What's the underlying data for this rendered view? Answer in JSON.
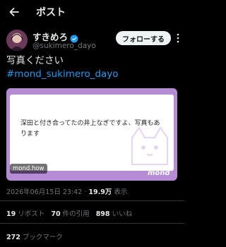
{
  "header": {
    "title": "ポスト"
  },
  "author": {
    "name": "すきめろ",
    "handle": "@sukimero_dayo",
    "follow_label": "フォローする"
  },
  "tweet": {
    "text": "写真ください",
    "hashtag": "#mond_sukimero_dayo"
  },
  "card": {
    "text": "深田と付き合ってたの井上なぎですよ、写真もあります",
    "domain": "mond.how",
    "logo": "mond"
  },
  "meta": {
    "date": "2026年06月15日 23:42",
    "separator": "·",
    "views": "19.9万",
    "views_label": "表示"
  },
  "stats": {
    "reposts": "19",
    "reposts_label": "リポスト",
    "quotes": "70",
    "quotes_label": "件の引用",
    "likes": "898",
    "likes_label": "いいね",
    "bookmarks": "272",
    "bookmarks_label": "ブックマーク"
  },
  "colors": {
    "accent": "#1d9bf0",
    "card_bg": "#b58bd6",
    "background": "#000000"
  }
}
